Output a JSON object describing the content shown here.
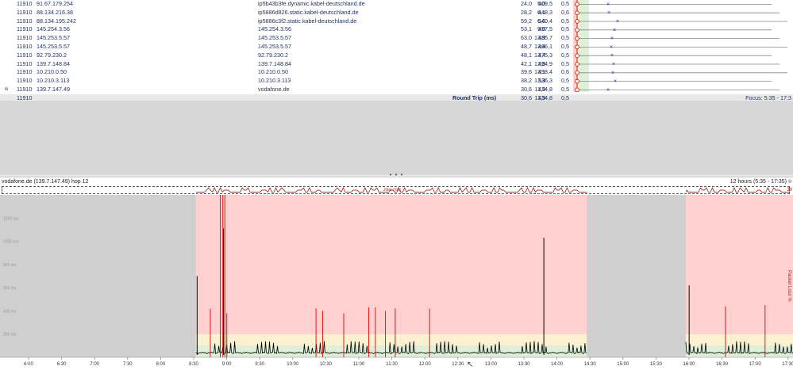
{
  "hops": [
    {
      "asn": "11910",
      "ip": "91.67.179.254",
      "name": "ip5b43b3fe.dynamic.kabel-deutschland.de",
      "avg": "24,0",
      "min": "5,0",
      "cur": "409,5",
      "pl": "0,5",
      "marker": 42
    },
    {
      "asn": "11910",
      "ip": "88.134.216.38",
      "name": "ip5886d826.static.kabel-deutschland.de",
      "avg": "28,2",
      "min": "6,1",
      "cur": "448,3",
      "pl": "0,6",
      "marker": 43
    },
    {
      "asn": "11910",
      "ip": "88.134.195.242",
      "name": "ip5886c3f2.static.kabel-deutschland.de",
      "avg": "59,2",
      "min": "6,0",
      "cur": "540,4",
      "pl": "0,5",
      "marker": 54
    },
    {
      "asn": "11910",
      "ip": "145.254.3.56",
      "name": "145.254.3.56",
      "avg": "53,1",
      "min": "9,0",
      "cur": "497,5",
      "pl": "0,5",
      "marker": 50
    },
    {
      "asn": "11910",
      "ip": "145.253.5.57",
      "name": "145.253.5.57",
      "avg": "63,0",
      "min": "13,9",
      "cur": "485,7",
      "pl": "0,5",
      "marker": 47
    },
    {
      "asn": "11910",
      "ip": "145.253.5.57",
      "name": "145.253.5.57",
      "avg": "48,7",
      "min": "13,4",
      "cur": "466,1",
      "pl": "0,5",
      "marker": 46
    },
    {
      "asn": "11910",
      "ip": "92.79.230.2",
      "name": "92.79.230.2",
      "avg": "48,1",
      "min": "13,4",
      "cur": "475,3",
      "pl": "0,5",
      "marker": 47
    },
    {
      "asn": "11910",
      "ip": "139.7.148.84",
      "name": "139.7.148.84",
      "avg": "42,1",
      "min": "12,8",
      "cur": "494,9",
      "pl": "0,5",
      "marker": 49
    },
    {
      "asn": "11910",
      "ip": "10.210.0.50",
      "name": "10.210.0.50",
      "avg": "39,6",
      "min": "13,1",
      "cur": "498,4",
      "pl": "0,6",
      "marker": 48
    },
    {
      "asn": "11910",
      "ip": "10.210.3.113",
      "name": "10.210.3.113",
      "avg": "38,2",
      "min": "13,3",
      "cur": "536,3",
      "pl": "0,5",
      "marker": 51
    },
    {
      "asn": "11910",
      "ip": "139.7.147.49",
      "name": "vodafone.de",
      "avg": "30,6",
      "min": "11,9",
      "cur": "434,8",
      "pl": "0,5",
      "marker": 42,
      "icon": "bar-chart-icon"
    }
  ],
  "footer": {
    "asn": "11910",
    "label": "Round Trip (ms)",
    "avg": "30,6",
    "min": "11,9",
    "cur": "434,8",
    "pl": "0,5",
    "focus": "Focus: 5:35 - 17:3"
  },
  "splitter_glyph": "• • •",
  "graph": {
    "title": "vodafone.de (139.7.147.49) hop 12",
    "range": "12 hours (5:35 - 17:35)",
    "jitter_label": "Jitter (ms)",
    "jitter_max": "30",
    "pl_axis_label": "Packet Loss %",
    "y_ticks": [
      "1200 ms",
      "1000 ms",
      "800 ms",
      "600 ms",
      "400 ms",
      "200 ms"
    ],
    "x_ticks": [
      "6:00",
      "6:30",
      "7:00",
      "7:30",
      "8:00",
      "8:30",
      "9:00",
      "9:30",
      "10:00",
      "10:30",
      "11:00",
      "11:30",
      "12:00",
      "12:30",
      "13:00",
      "13:30",
      "14:00",
      "14:30",
      "15:00",
      "15:30",
      "16:00",
      "16:30",
      "17:00",
      "17:30"
    ]
  },
  "colors": {
    "good": "#dff0d8",
    "warn": "#fbf0cf",
    "bad": "#ffd0d0",
    "nodata": "#cfcfcf",
    "line": "#000000",
    "loss": "#e00000",
    "text": "#1f2f5f"
  }
}
